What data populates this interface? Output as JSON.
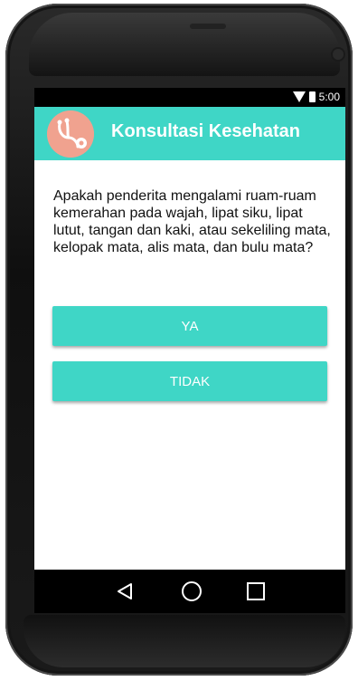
{
  "status_bar": {
    "time": "5:00",
    "wifi_icon": "wifi-icon",
    "battery_icon": "battery-icon"
  },
  "app_bar": {
    "title": "Konsultasi Kesehatan",
    "logo_icon": "stethoscope-icon",
    "accent_color": "#3fd6c6"
  },
  "question": {
    "text": "Apakah penderita mengalami ruam-ruam kemerahan pada wajah, lipat siku, lipat lutut, tangan dan kaki, atau sekeliling mata, kelopak mata, alis mata, dan bulu mata?"
  },
  "answers": {
    "yes_label": "YA",
    "no_label": "TIDAK"
  },
  "nav_bar": {
    "back_icon": "back-triangle-icon",
    "home_icon": "home-circle-icon",
    "recent_icon": "recent-square-icon"
  }
}
